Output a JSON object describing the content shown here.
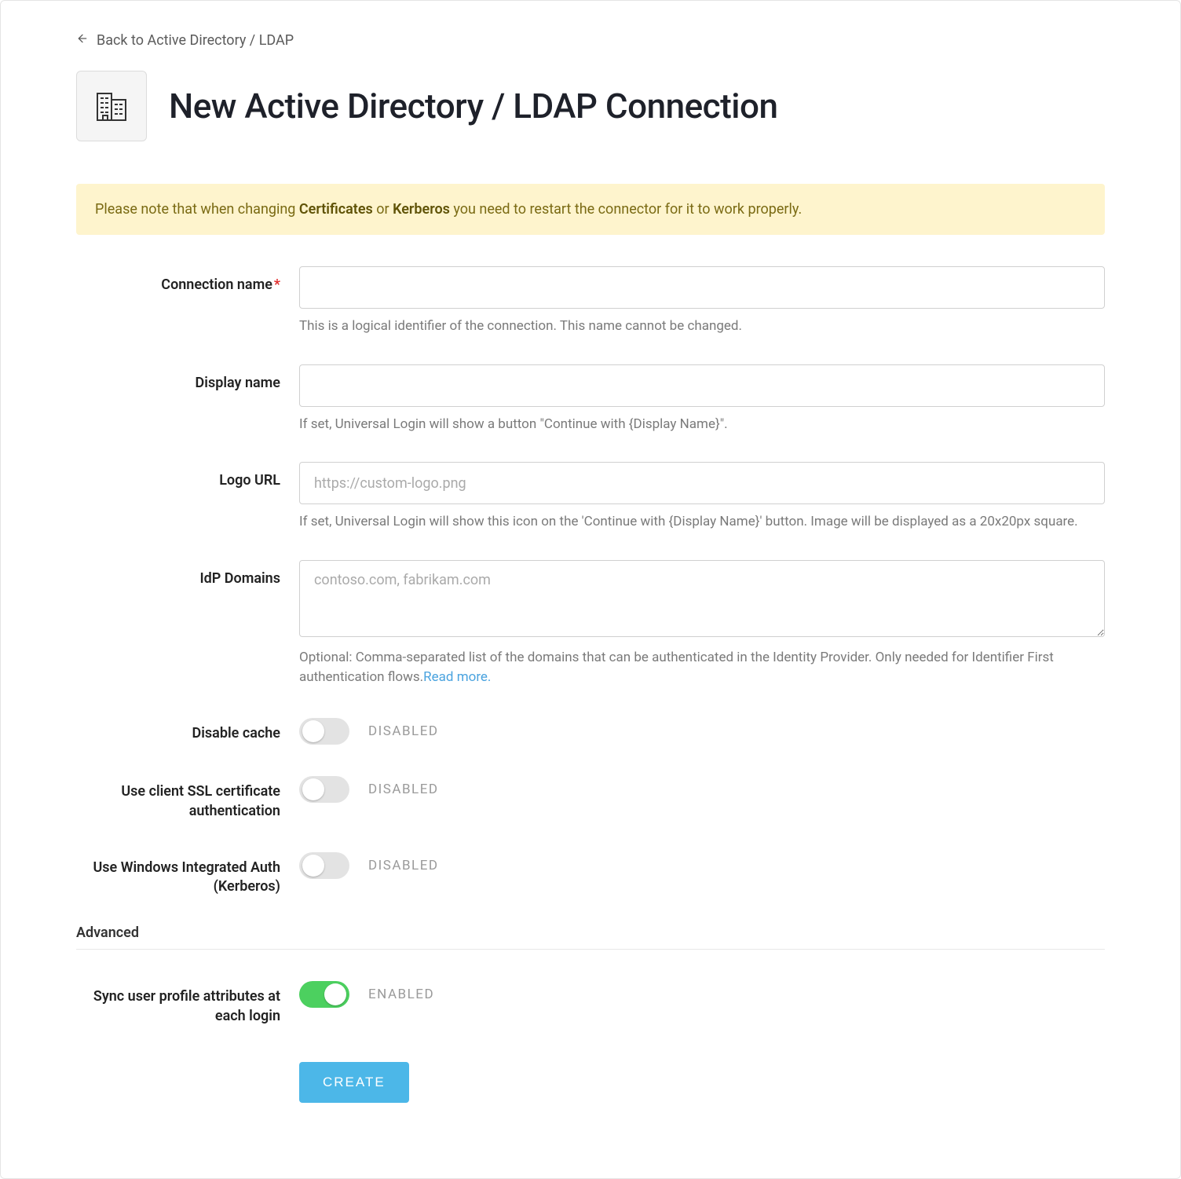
{
  "back_link": "Back to Active Directory / LDAP",
  "page_title": "New Active Directory / LDAP Connection",
  "notice": {
    "prefix": "Please note that when changing ",
    "strong1": "Certificates",
    "middle": " or ",
    "strong2": "Kerberos",
    "suffix": " you need to restart the connector for it to work properly."
  },
  "fields": {
    "connection_name": {
      "label": "Connection name",
      "required": true,
      "value": "",
      "hint": "This is a logical identifier of the connection. This name cannot be changed."
    },
    "display_name": {
      "label": "Display name",
      "value": "",
      "hint": "If set, Universal Login will show a button \"Continue with {Display Name}\"."
    },
    "logo_url": {
      "label": "Logo URL",
      "value": "",
      "placeholder": "https://custom-logo.png",
      "hint": "If set, Universal Login will show this icon on the 'Continue with {Display Name}' button. Image will be displayed as a 20x20px square."
    },
    "idp_domains": {
      "label": "IdP Domains",
      "value": "",
      "placeholder": "contoso.com, fabrikam.com",
      "hint_prefix": "Optional: Comma-separated list of the domains that can be authenticated in the Identity Provider. Only needed for Identifier First authentication flows.",
      "hint_link": "Read more."
    },
    "disable_cache": {
      "label": "Disable cache",
      "enabled": false,
      "status": "DISABLED"
    },
    "client_ssl": {
      "label": "Use client SSL certificate authentication",
      "enabled": false,
      "status": "DISABLED"
    },
    "kerberos_auth": {
      "label": "Use Windows Integrated Auth (Kerberos)",
      "enabled": false,
      "status": "DISABLED"
    },
    "sync_profile": {
      "label": "Sync user profile attributes at each login",
      "enabled": true,
      "status": "ENABLED"
    }
  },
  "sections": {
    "advanced": "Advanced"
  },
  "actions": {
    "create": "CREATE"
  }
}
